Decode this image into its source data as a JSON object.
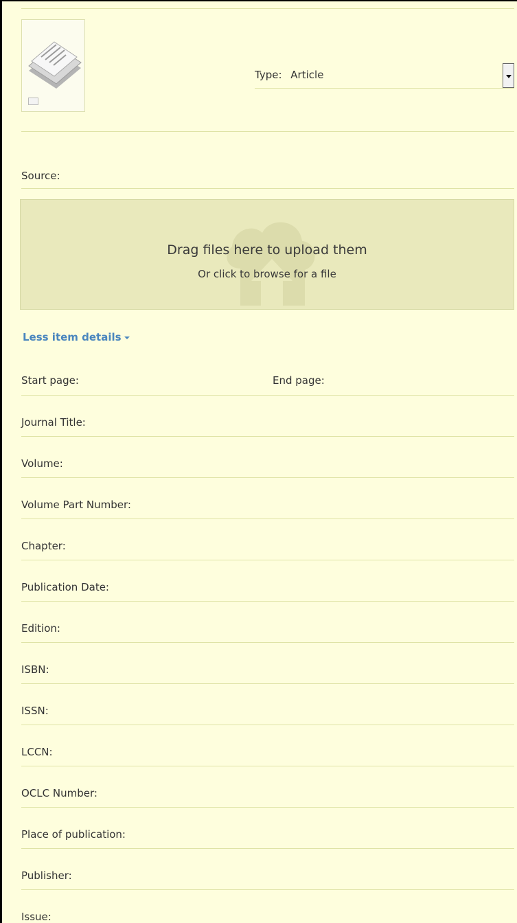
{
  "type": {
    "label": "Type:",
    "value": "Article"
  },
  "source": {
    "label": "Source:"
  },
  "upload": {
    "title": "Drag files here to upload them",
    "subtitle": "Or click to browse for a file"
  },
  "details_toggle": "Less item details",
  "pages": {
    "start_label": "Start page:",
    "end_label": "End page:"
  },
  "fields": [
    {
      "label": "Journal Title:"
    },
    {
      "label": "Volume:"
    },
    {
      "label": "Volume Part Number:"
    },
    {
      "label": "Chapter:"
    },
    {
      "label": "Publication Date:"
    },
    {
      "label": "Edition:"
    },
    {
      "label": "ISBN:"
    },
    {
      "label": "ISSN:"
    },
    {
      "label": "LCCN:"
    },
    {
      "label": "OCLC Number:"
    },
    {
      "label": "Place of publication:"
    },
    {
      "label": "Publisher:"
    },
    {
      "label": "Issue:"
    }
  ],
  "icons": {
    "thumbnail": "document-stack-icon",
    "thumbnail_badge": "image-icon",
    "upload": "cloud-upload-icon",
    "dropdown": "dropdown-arrow-icon"
  },
  "colors": {
    "background": "#fefedd",
    "upload_area": "#e9e9bc",
    "link": "#4a86be"
  }
}
